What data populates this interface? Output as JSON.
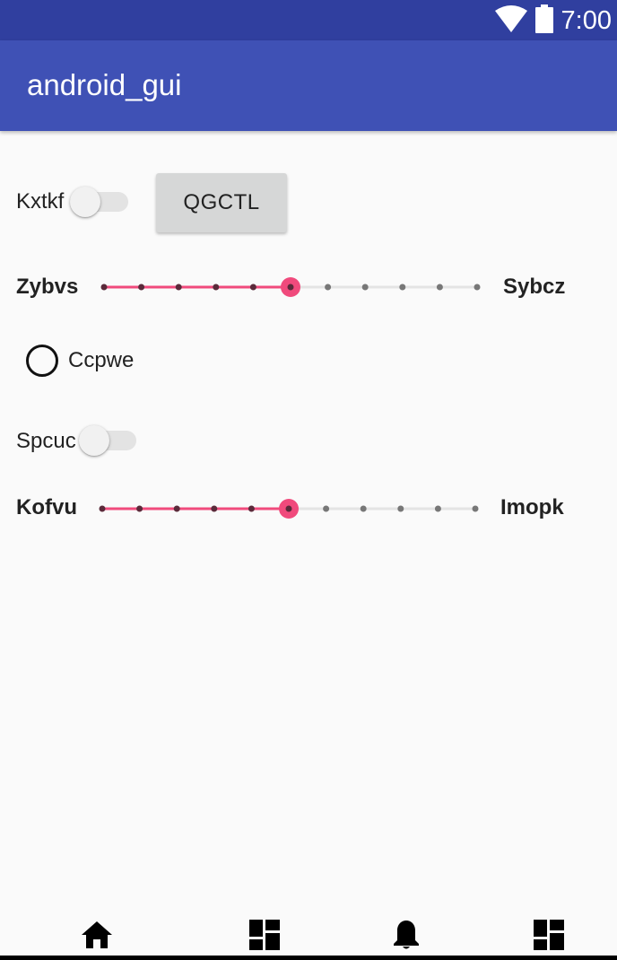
{
  "status_bar": {
    "time": "7:00",
    "icons": [
      "wifi-icon",
      "battery-icon"
    ]
  },
  "app_bar": {
    "title": "android_gui"
  },
  "switch_1": {
    "label": "Kxtkf",
    "checked": false
  },
  "button_1": {
    "label": "QGCTL"
  },
  "slider_1": {
    "left_label": "Zybvs",
    "right_label": "Sybcz",
    "steps": 10,
    "value": 5,
    "accent": "#f04a7c"
  },
  "radio_1": {
    "label": "Ccpwe",
    "checked": false
  },
  "switch_2": {
    "label": "Spcuc",
    "checked": false
  },
  "slider_2": {
    "left_label": "Kofvu",
    "right_label": "Imopk",
    "steps": 10,
    "value": 5,
    "accent": "#f04a7c"
  },
  "bottom_nav": {
    "items": [
      "home-icon",
      "dashboard-icon",
      "notifications-icon",
      "dashboard-icon"
    ]
  },
  "colors": {
    "status_bar": "#303f9f",
    "app_bar": "#3f51b5",
    "accent": "#f04a7c",
    "background": "#fafafa"
  }
}
